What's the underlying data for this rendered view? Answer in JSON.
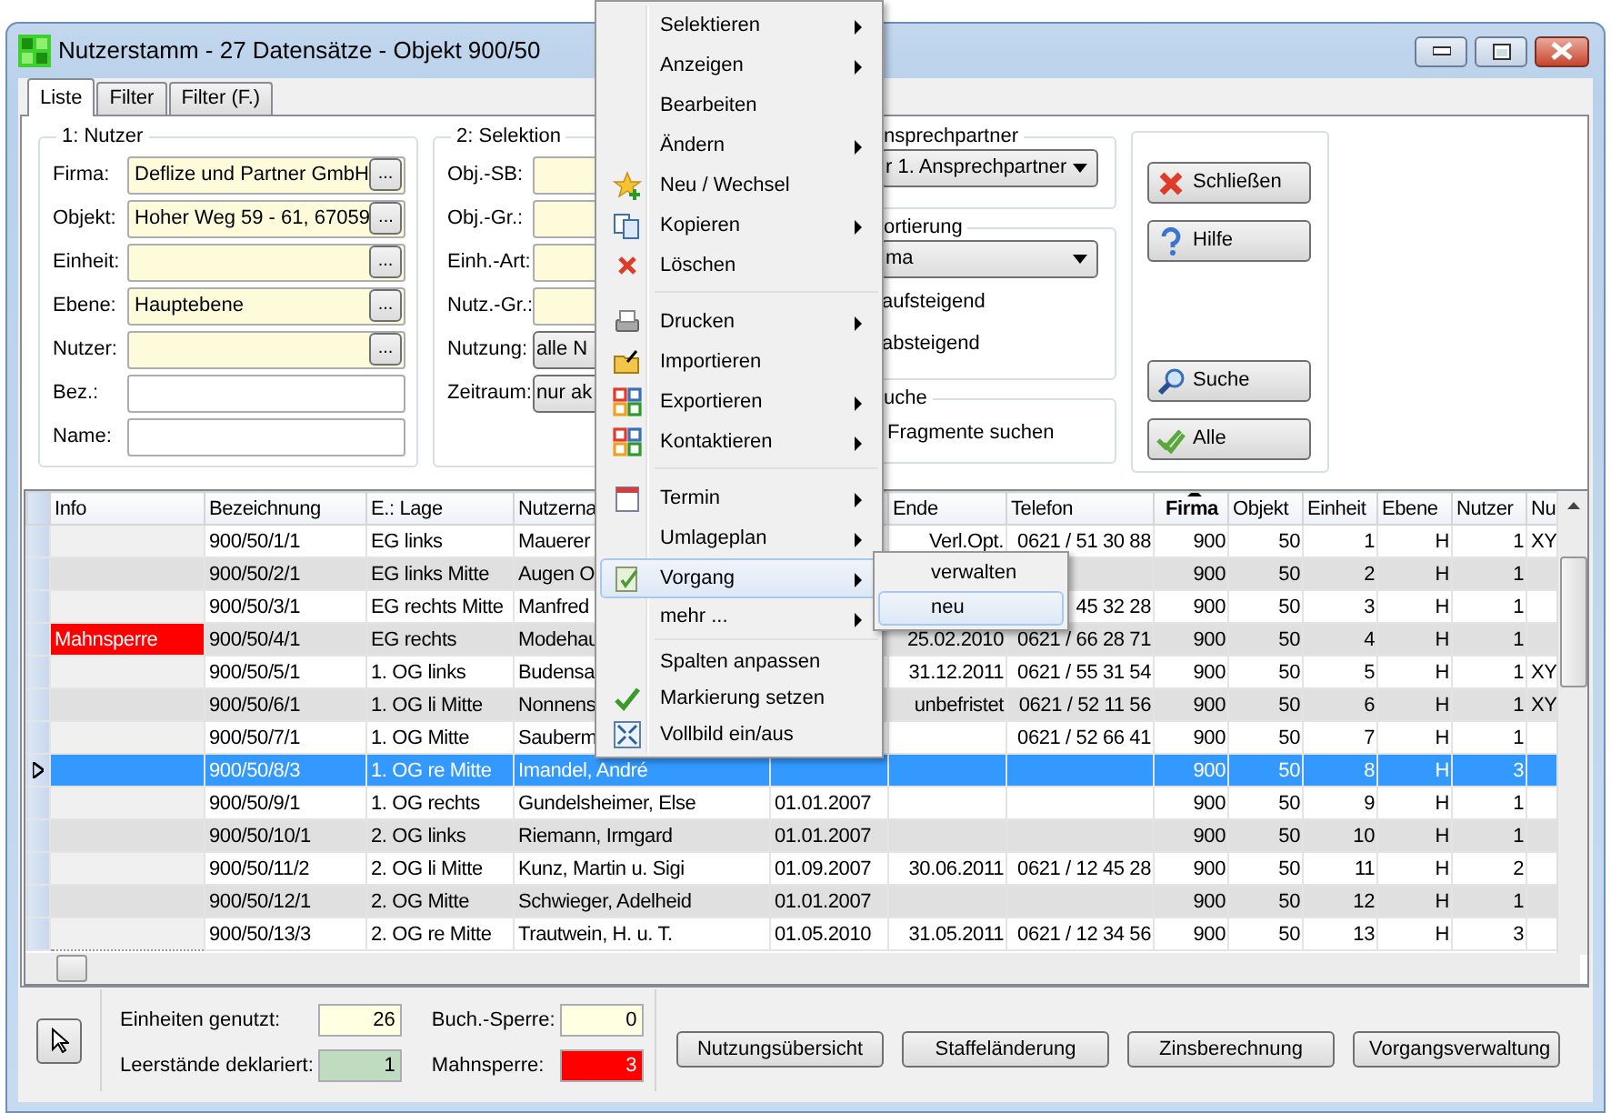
{
  "window": {
    "title": "Nutzerstamm - 27 Datensätze - Objekt 900/50"
  },
  "tabs": [
    {
      "label": "Liste",
      "selected": true
    },
    {
      "label": "Filter",
      "selected": false
    },
    {
      "label": "Filter (F.)",
      "selected": false
    }
  ],
  "nutzer_group": {
    "title": "1: Nutzer",
    "fields": [
      {
        "label": "Firma:",
        "value": "Deflize und Partner GmbH",
        "button": "..."
      },
      {
        "label": "Objekt:",
        "value": "Hoher Weg 59 - 61, 67059",
        "button": "..."
      },
      {
        "label": "Einheit:",
        "button": "..."
      },
      {
        "label": "Ebene:",
        "value": "Hauptebene",
        "button": "..."
      },
      {
        "label": "Nutzer:",
        "button": "..."
      },
      {
        "label": "Bez.:"
      },
      {
        "label": "Name:"
      }
    ]
  },
  "selektion_group": {
    "title": "2: Selektion",
    "fields": [
      {
        "label": "Obj.-SB:",
        "kind": "field"
      },
      {
        "label": "Obj.-Gr.:",
        "kind": "field"
      },
      {
        "label": "Einh.-Art:",
        "kind": "field"
      },
      {
        "label": "Nutz.-Gr.:",
        "kind": "field"
      },
      {
        "label": "Nutzung:",
        "kind": "combo",
        "value": "alle N"
      },
      {
        "label": "Zeitraum:",
        "kind": "combo",
        "value": "nur ak"
      }
    ]
  },
  "ansprechpartner_group": {
    "title": "nsprechpartner",
    "combo": "r 1. Ansprechpartner"
  },
  "sortierung_group": {
    "title": "ortierung",
    "combo": "ma",
    "options": [
      "aufsteigend",
      "absteigend"
    ]
  },
  "suche_group": {
    "title": "uche",
    "option": "Fragmente suchen"
  },
  "side_buttons": [
    {
      "label": "Schließen"
    },
    {
      "label": "Hilfe"
    },
    {
      "label": "Suche"
    },
    {
      "label": "Alle"
    }
  ],
  "table": {
    "columns": [
      {
        "label": "Info"
      },
      {
        "label": "Bezeichnung"
      },
      {
        "label": "E.: Lage"
      },
      {
        "label": "Nutzerna"
      },
      {},
      {
        "label": "Ende"
      },
      {
        "label": "Telefon"
      },
      {
        "label": "Firma",
        "sorted": true
      },
      {
        "label": "Objekt"
      },
      {
        "label": "Einheit"
      },
      {
        "label": "Ebene"
      },
      {
        "label": "Nutzer"
      },
      {
        "label": "Nu"
      }
    ],
    "rows": [
      {
        "selected": false,
        "bezeichnung": "900/50/1/1",
        "lage": "EG links",
        "nutzername": "Mauerer",
        "ende": "Verl.Opt.",
        "telefon": "0621 / 51 30 88",
        "firma": "900",
        "objekt": "50",
        "einheit": "1",
        "ebene": "H",
        "nutzer": "1",
        "nu": "XY"
      },
      {
        "selected": false,
        "bezeichnung": "900/50/2/1",
        "lage": "EG links Mitte",
        "nutzername": "Augen O",
        "firma": "900",
        "objekt": "50",
        "einheit": "2",
        "ebene": "H",
        "nutzer": "1"
      },
      {
        "selected": false,
        "bezeichnung": "900/50/3/1",
        "lage": "EG rechts Mitte",
        "nutzername": "Manfred",
        "telefon": "45 32 28",
        "firma": "900",
        "objekt": "50",
        "einheit": "3",
        "ebene": "H",
        "nutzer": "1"
      },
      {
        "selected": false,
        "info": "Mahnsperre",
        "color": "#ff0000",
        "bezeichnung": "900/50/4/1",
        "lage": "EG rechts",
        "nutzername": "Modehau",
        "ende": "25.02.2010",
        "telefon": "0621 / 66 28 71",
        "firma": "900",
        "objekt": "50",
        "einheit": "4",
        "ebene": "H",
        "nutzer": "1"
      },
      {
        "selected": false,
        "bezeichnung": "900/50/5/1",
        "lage": "1. OG links",
        "nutzername": "Budensa",
        "ende": "31.12.2011",
        "telefon": "0621 / 55 31 54",
        "firma": "900",
        "objekt": "50",
        "einheit": "5",
        "ebene": "H",
        "nutzer": "1",
        "nu": "XY"
      },
      {
        "selected": false,
        "bezeichnung": "900/50/6/1",
        "lage": "1. OG li Mitte",
        "nutzername": "Nonnens",
        "ende": "unbefristet",
        "telefon": "0621 / 52 11 56",
        "firma": "900",
        "objekt": "50",
        "einheit": "6",
        "ebene": "H",
        "nutzer": "1",
        "nu": "XY"
      },
      {
        "selected": false,
        "bezeichnung": "900/50/7/1",
        "lage": "1. OG Mitte",
        "nutzername": "Sauberm",
        "telefon": "0621 / 52 66 41",
        "firma": "900",
        "objekt": "50",
        "einheit": "7",
        "ebene": "H",
        "nutzer": "1"
      },
      {
        "selected": true,
        "bezeichnung": "900/50/8/3",
        "lage": "1. OG re Mitte",
        "nutzername": "Imandel, André",
        "firma": "900",
        "objekt": "50",
        "einheit": "8",
        "ebene": "H",
        "nutzer": "3"
      },
      {
        "selected": false,
        "bezeichnung": "900/50/9/1",
        "lage": "1. OG rechts",
        "nutzername": "Gundelsheimer, Else",
        "beginn": "01.01.2007",
        "firma": "900",
        "objekt": "50",
        "einheit": "9",
        "ebene": "H",
        "nutzer": "1"
      },
      {
        "selected": false,
        "bezeichnung": "900/50/10/1",
        "lage": "2. OG links",
        "nutzername": "Riemann, Irmgard",
        "beginn": "01.01.2007",
        "firma": "900",
        "objekt": "50",
        "einheit": "10",
        "ebene": "H",
        "nutzer": "1"
      },
      {
        "selected": false,
        "bezeichnung": "900/50/11/2",
        "lage": "2. OG li Mitte",
        "nutzername": "Kunz, Martin u. Sigi",
        "beginn": "01.09.2007",
        "ende": "30.06.2011",
        "telefon": "0621 / 12 45 28",
        "firma": "900",
        "objekt": "50",
        "einheit": "11",
        "ebene": "H",
        "nutzer": "2"
      },
      {
        "selected": false,
        "bezeichnung": "900/50/12/1",
        "lage": "2. OG Mitte",
        "nutzername": "Schwieger, Adelheid",
        "beginn": "01.01.2007",
        "firma": "900",
        "objekt": "50",
        "einheit": "12",
        "ebene": "H",
        "nutzer": "1"
      },
      {
        "selected": false,
        "bezeichnung": "900/50/13/3",
        "lage": "2. OG re Mitte",
        "nutzername": "Trautwein, H. u. T.",
        "beginn": "01.05.2010",
        "ende": "31.05.2011",
        "telefon": "0621 / 12 34 56",
        "firma": "900",
        "objekt": "50",
        "einheit": "13",
        "ebene": "H",
        "nutzer": "3"
      }
    ]
  },
  "stats": [
    {
      "label": "Einheiten genutzt:",
      "value": "26",
      "color": "#ffffe1"
    },
    {
      "label": "Leerstände deklariert:",
      "value": "1",
      "color": "#c0dcc0"
    },
    {
      "label": "Buch.-Sperre:",
      "value": "0",
      "color": "#ffffe1"
    },
    {
      "label": "Mahnsperre:",
      "value": "3",
      "color": "#ff0000"
    }
  ],
  "bottom_buttons": [
    "Nutzungsübersicht",
    "Staffeländerung",
    "Zinsberechnung",
    "Vorgangsverwaltung"
  ],
  "context_menu": {
    "items": [
      {
        "kind": "item",
        "label": "Selektieren",
        "submenu": true,
        "selected": false
      },
      {
        "kind": "item",
        "label": "Anzeigen",
        "submenu": true,
        "selected": false
      },
      {
        "kind": "item",
        "label": "Bearbeiten",
        "submenu": false,
        "selected": false
      },
      {
        "kind": "item",
        "label": "Ändern",
        "submenu": true,
        "selected": false
      },
      {
        "kind": "item",
        "label": "Neu / Wechsel",
        "submenu": false,
        "selected": false
      },
      {
        "kind": "item",
        "label": "Kopieren",
        "submenu": true,
        "selected": false
      },
      {
        "kind": "item",
        "label": "Löschen",
        "submenu": false,
        "selected": false
      },
      {
        "kind": "separator"
      },
      {
        "kind": "item",
        "label": "Drucken",
        "submenu": true,
        "selected": false
      },
      {
        "kind": "item",
        "label": "Importieren",
        "submenu": false,
        "selected": false
      },
      {
        "kind": "item",
        "label": "Exportieren",
        "submenu": true,
        "selected": false
      },
      {
        "kind": "item",
        "label": "Kontaktieren",
        "submenu": true,
        "selected": false
      },
      {
        "kind": "separator"
      },
      {
        "kind": "item",
        "label": "Termin",
        "submenu": true,
        "selected": false
      },
      {
        "kind": "item",
        "label": "Umlageplan",
        "submenu": true,
        "selected": false
      },
      {
        "kind": "item",
        "label": "Vorgang",
        "submenu": true,
        "selected": true
      },
      {
        "kind": "item",
        "label": "mehr ...",
        "submenu": true,
        "selected": false
      },
      {
        "kind": "separator"
      },
      {
        "kind": "item",
        "label": "Spalten anpassen",
        "submenu": false,
        "selected": false
      },
      {
        "kind": "item",
        "label": "Markierung setzen",
        "submenu": false,
        "selected": false
      },
      {
        "kind": "item",
        "label": "Vollbild ein/aus",
        "submenu": false,
        "selected": false
      }
    ],
    "submenu": [
      {
        "label": "verwalten",
        "selected": false
      },
      {
        "label": "neu",
        "selected": true
      }
    ]
  }
}
